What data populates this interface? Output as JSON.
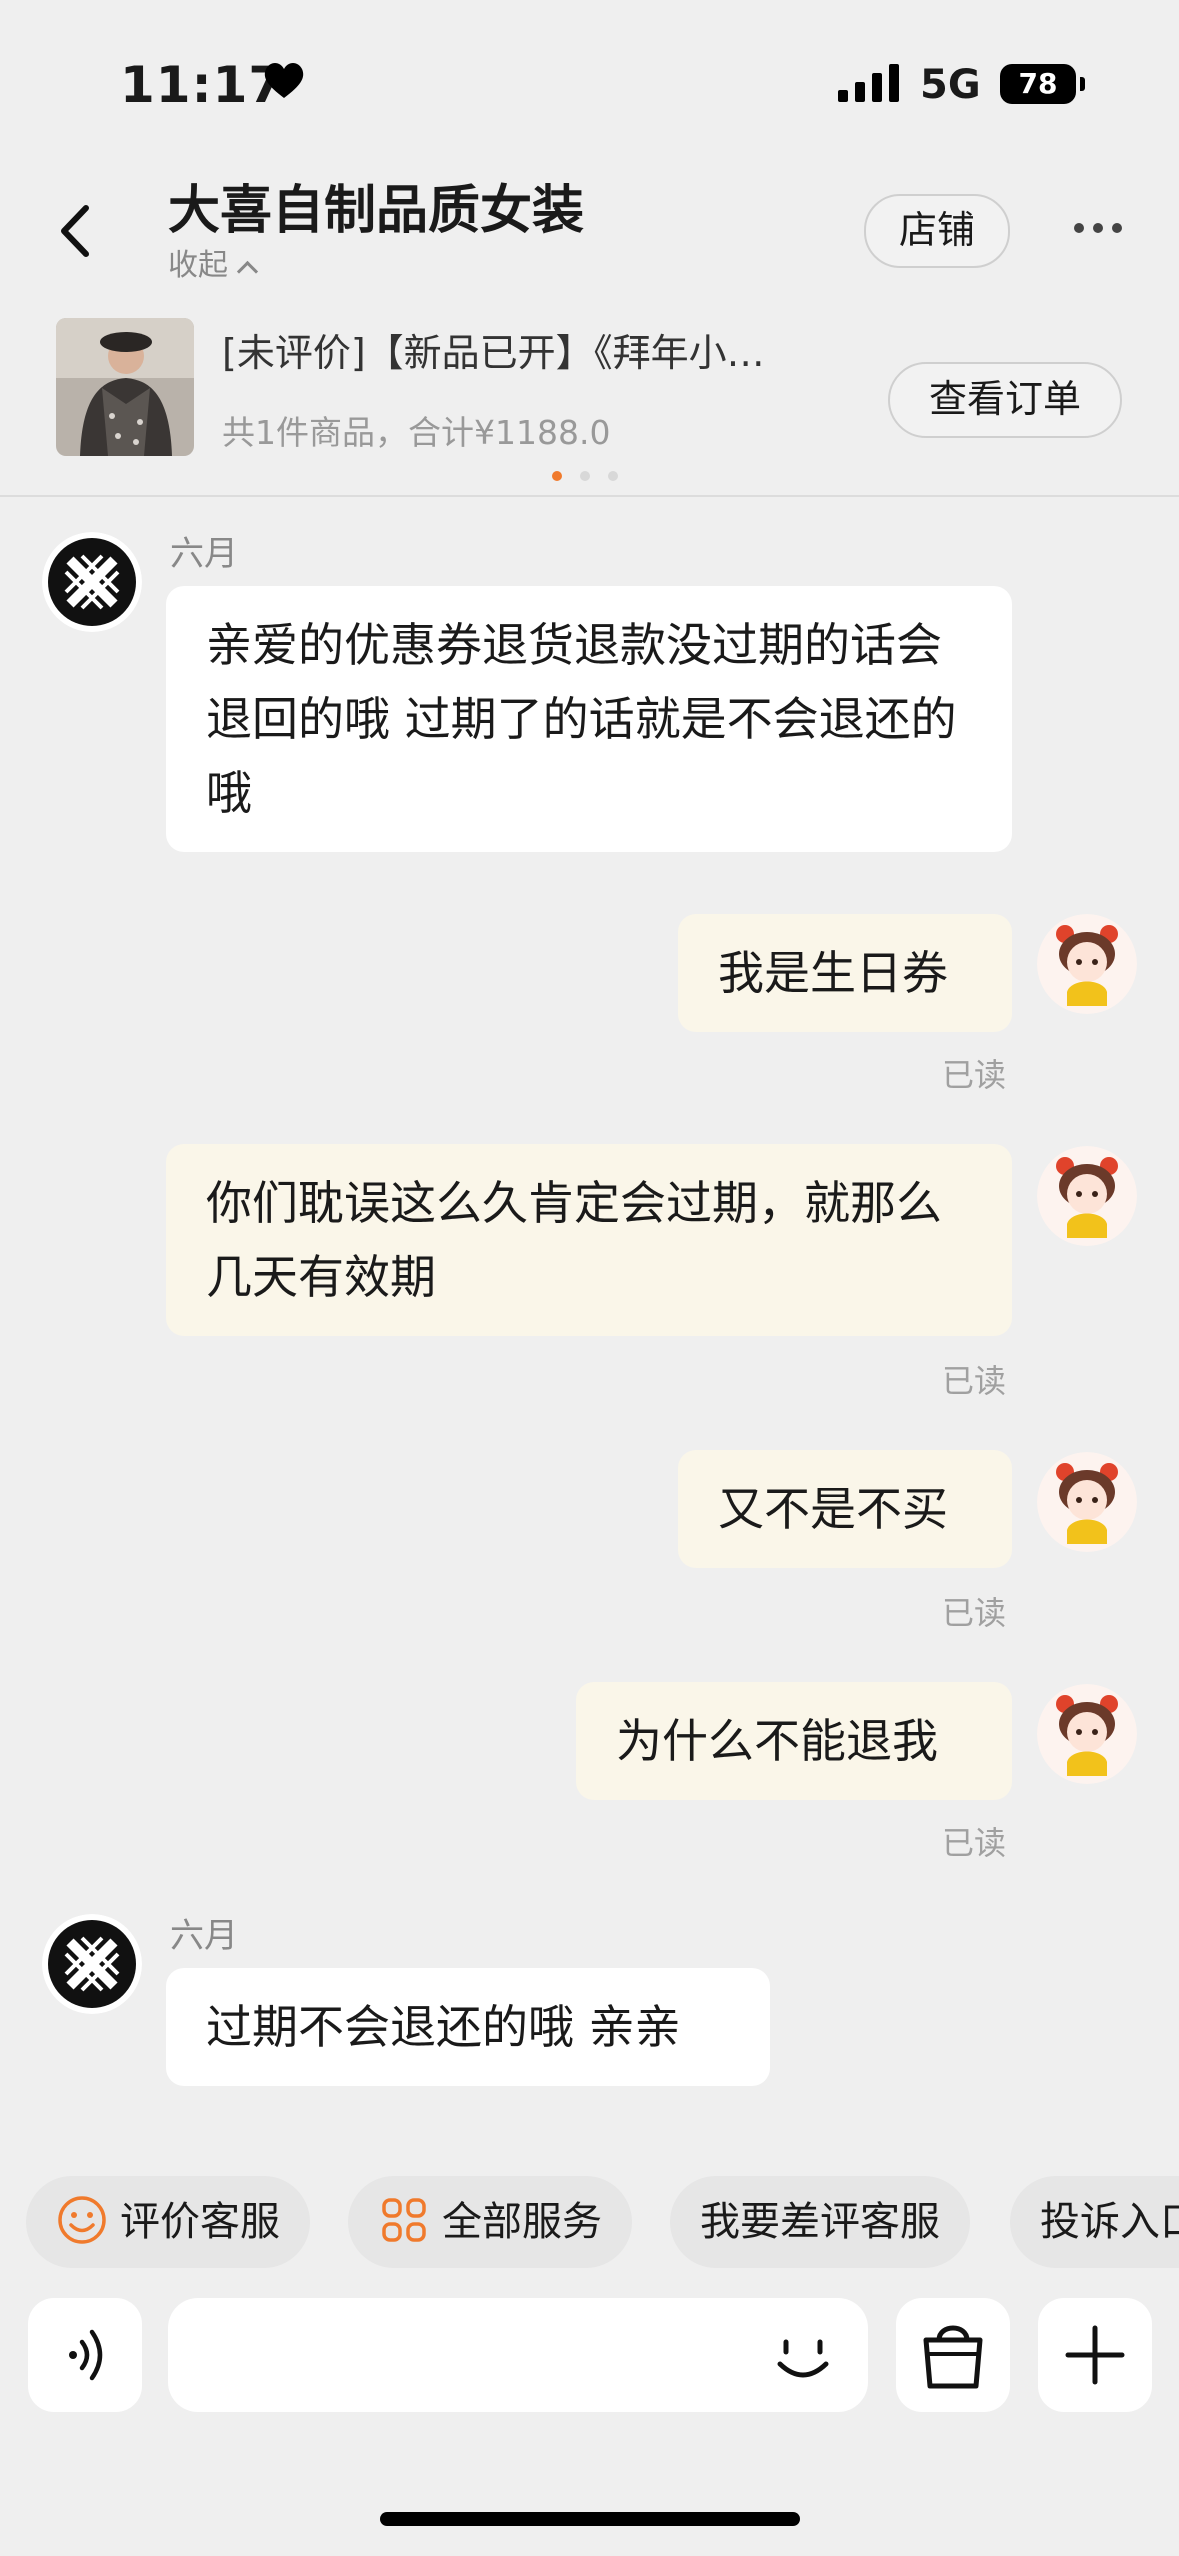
{
  "status": {
    "time": "11:17",
    "network": "5G",
    "battery": "78"
  },
  "header": {
    "title": "大喜自制品质女装",
    "collapse": "收起",
    "store_button": "店铺"
  },
  "order": {
    "title": "[未评价]【新品已开】《拜年小…",
    "summary": "共1件商品，合计¥1188.0",
    "view_button": "查看订单"
  },
  "messages": [
    {
      "sender": "六月",
      "text": "亲爱的优惠券退货退款没过期的话会退回的哦 过期了的话就是不会退还的哦"
    },
    {
      "text": "我是生日券",
      "status": "已读"
    },
    {
      "text": "你们耽误这么久肯定会过期，就那么几天有效期",
      "status": "已读"
    },
    {
      "text": "又不是不买",
      "status": "已读"
    },
    {
      "text": "为什么不能退我",
      "status": "已读"
    },
    {
      "sender": "六月",
      "text": "过期不会退还的哦 亲亲"
    }
  ],
  "quick_actions": [
    {
      "label": "评价客服",
      "icon": "smiley-icon"
    },
    {
      "label": "全部服务",
      "icon": "grid-icon"
    },
    {
      "label": "我要差评客服"
    },
    {
      "label": "投诉入口"
    }
  ],
  "input": {
    "placeholder": ""
  },
  "colors": {
    "accent": "#f07a2c",
    "incoming_bubble": "#ffffff",
    "outgoing_bubble": "#faf6e9",
    "background": "#efefef"
  }
}
